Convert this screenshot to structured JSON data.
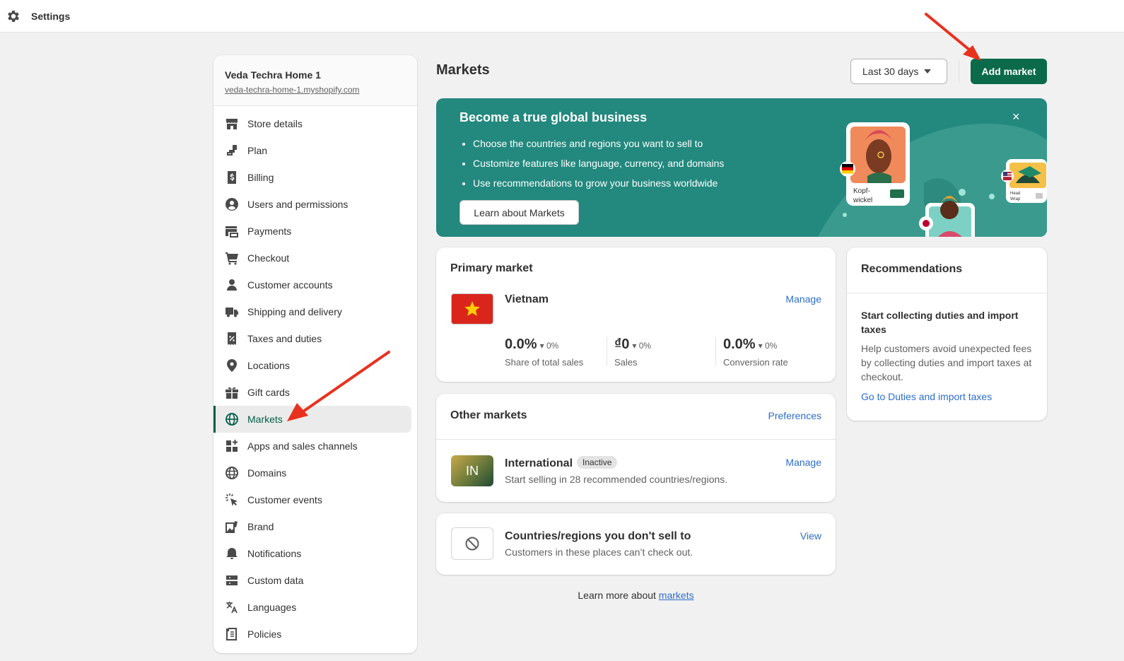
{
  "topbar": {
    "title": "Settings",
    "icon": "gear-icon"
  },
  "store": {
    "name": "Veda Techra Home 1",
    "url": "veda-techra-home-1.myshopify.com"
  },
  "sidebar": {
    "items": [
      {
        "label": "Store details",
        "icon": "store-icon"
      },
      {
        "label": "Plan",
        "icon": "plan-icon"
      },
      {
        "label": "Billing",
        "icon": "billing-icon"
      },
      {
        "label": "Users and permissions",
        "icon": "user-circle-icon"
      },
      {
        "label": "Payments",
        "icon": "payments-icon"
      },
      {
        "label": "Checkout",
        "icon": "cart-icon"
      },
      {
        "label": "Customer accounts",
        "icon": "person-icon"
      },
      {
        "label": "Shipping and delivery",
        "icon": "truck-icon"
      },
      {
        "label": "Taxes and duties",
        "icon": "receipt-icon"
      },
      {
        "label": "Locations",
        "icon": "location-pin-icon"
      },
      {
        "label": "Gift cards",
        "icon": "gift-icon"
      },
      {
        "label": "Markets",
        "icon": "globe-icon",
        "active": true
      },
      {
        "label": "Apps and sales channels",
        "icon": "apps-icon"
      },
      {
        "label": "Domains",
        "icon": "domain-globe-icon"
      },
      {
        "label": "Customer events",
        "icon": "cursor-click-icon"
      },
      {
        "label": "Brand",
        "icon": "brand-image-icon"
      },
      {
        "label": "Notifications",
        "icon": "bell-icon"
      },
      {
        "label": "Custom data",
        "icon": "database-icon"
      },
      {
        "label": "Languages",
        "icon": "translate-icon"
      },
      {
        "label": "Policies",
        "icon": "document-icon"
      }
    ]
  },
  "header": {
    "title": "Markets",
    "date_range": "Last 30 days",
    "add_button": "Add market"
  },
  "banner": {
    "title": "Become a true global business",
    "bullets": [
      "Choose the countries and regions you want to sell to",
      "Customize features like language, currency, and domains",
      "Use recommendations to grow your business worldwide"
    ],
    "button": "Learn about Markets",
    "close": "×",
    "art_label_1": "Kopf-",
    "art_label_2": "wickel",
    "art_label_3": "Head",
    "art_label_4": "Wrap"
  },
  "primary_market": {
    "heading": "Primary market",
    "country": "Vietnam",
    "manage": "Manage",
    "stats": [
      {
        "value": "0.0%",
        "delta": "0%",
        "label": "Share of total sales"
      },
      {
        "value": "₫0",
        "delta": "0%",
        "label": "Sales"
      },
      {
        "value": "0.0%",
        "delta": "0%",
        "label": "Conversion rate"
      }
    ]
  },
  "other_markets": {
    "heading": "Other markets",
    "preferences": "Preferences",
    "item": {
      "badge": "IN",
      "name": "International",
      "status": "Inactive",
      "desc": "Start selling in 28 recommended countries/regions.",
      "manage": "Manage"
    }
  },
  "no_sell": {
    "title": "Countries/regions you don't sell to",
    "desc": "Customers in these places can’t check out.",
    "view": "View"
  },
  "recommendations": {
    "heading": "Recommendations",
    "title": "Start collecting duties and import taxes",
    "body": "Help customers avoid unexpected fees by collecting duties and import taxes at checkout.",
    "link": "Go to Duties and import taxes"
  },
  "footer": {
    "text": "Learn more about ",
    "link": "markets"
  },
  "colors": {
    "accent": "#0b6a4a",
    "banner": "#23887e",
    "link": "#2c6ecb",
    "annotation": "#e8321f"
  }
}
